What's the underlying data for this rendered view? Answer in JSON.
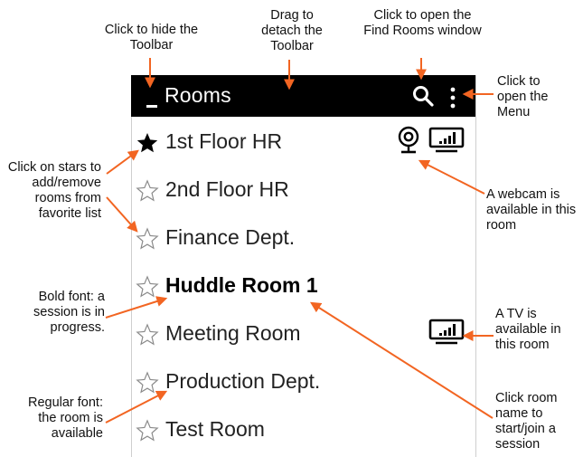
{
  "toolbar": {
    "title": "Rooms",
    "background": "#000000"
  },
  "rooms": [
    {
      "name": "1st Floor HR",
      "favorite": true,
      "bold": false,
      "webcam": true,
      "tv": true
    },
    {
      "name": "2nd Floor HR",
      "favorite": false,
      "bold": false,
      "webcam": false,
      "tv": false
    },
    {
      "name": "Finance Dept.",
      "favorite": false,
      "bold": false,
      "webcam": false,
      "tv": false
    },
    {
      "name": "Huddle Room 1",
      "favorite": false,
      "bold": true,
      "webcam": false,
      "tv": false
    },
    {
      "name": "Meeting Room",
      "favorite": false,
      "bold": false,
      "webcam": false,
      "tv": true
    },
    {
      "name": "Production Dept.",
      "favorite": false,
      "bold": false,
      "webcam": false,
      "tv": false
    },
    {
      "name": "Test Room",
      "favorite": false,
      "bold": false,
      "webcam": false,
      "tv": false
    }
  ],
  "annotations": {
    "hide_toolbar": "Click to hide the Toolbar",
    "detach_toolbar": "Drag to detach the Toolbar",
    "find_rooms": "Click to open the Find Rooms window",
    "open_menu": "Click to open the Menu",
    "stars": "Click on stars to add/remove rooms from favorite list",
    "webcam": "A webcam is available in this room",
    "bold_font": "Bold font: a session is in progress.",
    "tv": "A TV is available in this room",
    "regular_font": "Regular font: the room is available",
    "room_name": "Click room name to start/join a session"
  },
  "colors": {
    "arrow": "#f26522",
    "toolbar": "#000000",
    "text": "#000000"
  },
  "icons": {
    "search": "search-icon",
    "menu": "more-vert-icon",
    "hide": "minimize-icon",
    "star_filled": "star-filled-icon",
    "star_empty": "star-outline-icon",
    "webcam": "webcam-icon",
    "tv": "tv-icon"
  }
}
